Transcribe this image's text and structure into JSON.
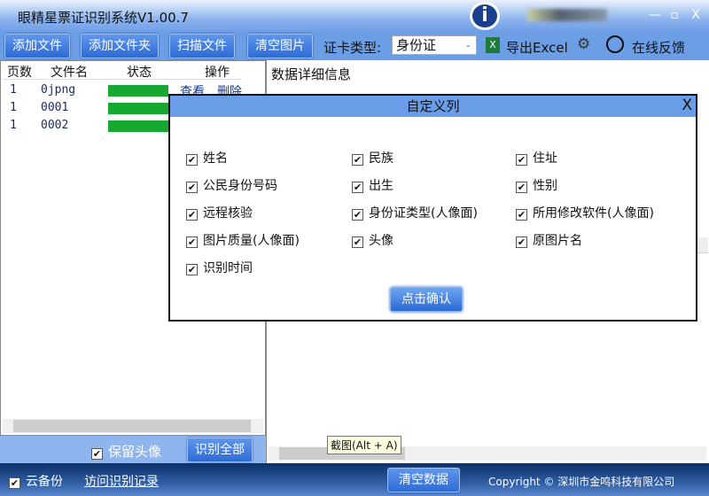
{
  "window": {
    "title": "眼精星票证识别系统V1.00.7",
    "logo_glyph": "i",
    "minimize": "—",
    "maximize": "▫",
    "close": "X"
  },
  "toolbar": {
    "add_file": "添加文件",
    "add_folder": "添加文件夹",
    "scan_file": "扫描文件",
    "clear_images": "清空图片",
    "card_type_label": "证卡类型:",
    "card_type_value": "身份证",
    "export_excel": "导出Excel",
    "feedback": "在线反馈"
  },
  "file_list": {
    "columns": [
      "页数",
      "文件名",
      "状态",
      "操作"
    ],
    "rows": [
      {
        "page": "1",
        "name": "0jpng",
        "progress": 100,
        "view": "查看",
        "delete": "删除"
      },
      {
        "page": "1",
        "name": "0001",
        "progress": 100
      },
      {
        "page": "1",
        "name": "0002",
        "progress": 100
      }
    ],
    "keep_avatar": "保留头像",
    "keep_avatar_checked": true,
    "recognize_all": "识别全部"
  },
  "detail": {
    "title": "数据详细信息"
  },
  "dialog": {
    "title": "自定义列",
    "close": "X",
    "confirm": "点击确认",
    "options": [
      {
        "label": "姓名",
        "checked": true
      },
      {
        "label": "民族",
        "checked": true
      },
      {
        "label": "住址",
        "checked": true
      },
      {
        "label": "公民身份号码",
        "checked": true
      },
      {
        "label": "出生",
        "checked": true
      },
      {
        "label": "性别",
        "checked": true
      },
      {
        "label": "远程核验",
        "checked": true
      },
      {
        "label": "身份证类型(人像面)",
        "checked": true
      },
      {
        "label": "所用修改软件(人像面)",
        "checked": true
      },
      {
        "label": "图片质量(人像面)",
        "checked": true
      },
      {
        "label": "头像",
        "checked": true
      },
      {
        "label": "原图片名",
        "checked": true
      },
      {
        "label": "识别时间",
        "checked": true
      }
    ]
  },
  "tooltip": "截图(Alt + A)",
  "footer": {
    "cloud_backup": "云备份",
    "cloud_backup_checked": true,
    "visit_records": "访问识别记录",
    "clear_data": "清空数据",
    "copyright": "Copyright © 深圳市金鸣科技有限公司"
  },
  "colors": {
    "accent": "#2e6ad6",
    "progress": "#17a832",
    "footer": "#1f4a8a"
  }
}
